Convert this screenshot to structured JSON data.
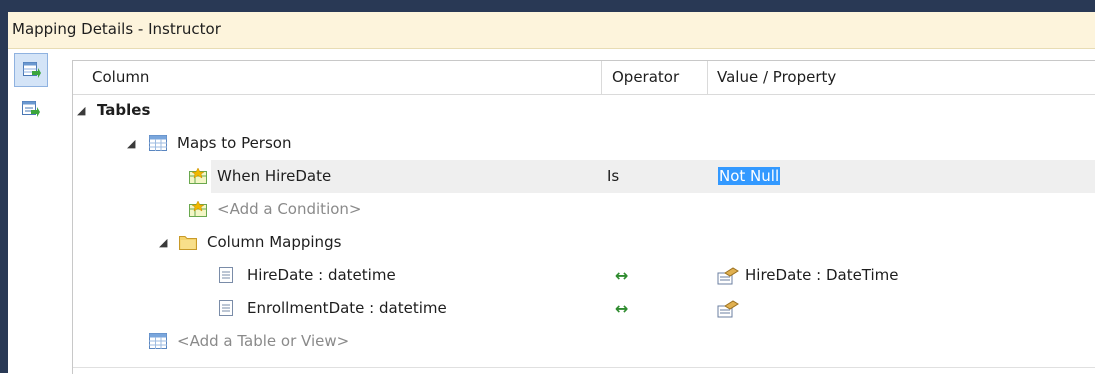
{
  "window": {
    "title": "Mapping Details - Instructor"
  },
  "toolbar": [
    {
      "icon": "map-entity-to-table-icon",
      "active": true
    },
    {
      "icon": "map-entity-to-functions-icon",
      "active": false
    }
  ],
  "grid": {
    "columns": [
      "Column",
      "Operator",
      "Value / Property"
    ],
    "rows": [
      {
        "id": "tables",
        "label": "Tables"
      },
      {
        "id": "maps_to",
        "label": "Maps to Person",
        "icon": "table-icon"
      },
      {
        "id": "condition",
        "label": "When HireDate",
        "operator": "Is",
        "value": "Not Null",
        "icon": "condition-icon",
        "selected": true
      },
      {
        "id": "add_condition",
        "label": "<Add a Condition>",
        "icon": "condition-icon"
      },
      {
        "id": "column_mappings",
        "label": "Column Mappings",
        "icon": "folder-icon"
      },
      {
        "id": "map1",
        "label": "HireDate : datetime",
        "operator": "↔",
        "value": "HireDate : DateTime",
        "icon": "column-icon"
      },
      {
        "id": "map2",
        "label": "EnrollmentDate : datetime",
        "operator": "↔",
        "value": "",
        "icon": "column-icon"
      },
      {
        "id": "add_table",
        "label": "<Add a Table or View>",
        "icon": "table-icon"
      }
    ]
  },
  "colors": {
    "frame": "#293955",
    "title_bg": "#fdf4dc",
    "selection": "#3399ff",
    "arrow": "#2e8b2e"
  }
}
